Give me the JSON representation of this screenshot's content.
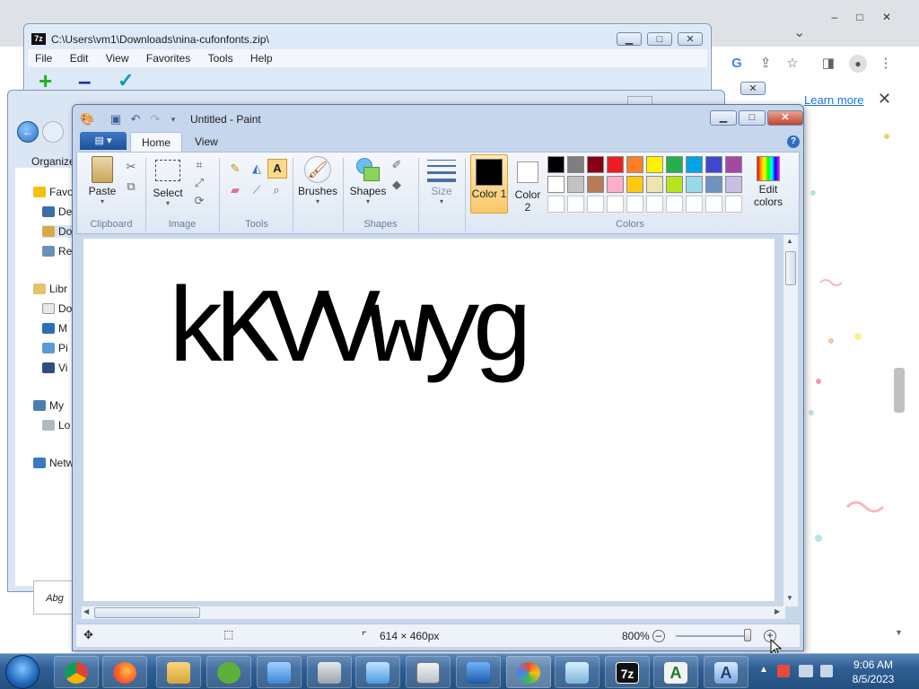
{
  "chrome": {
    "learn_more": "Learn more",
    "close_infobar": "✕",
    "window_controls": [
      "–",
      "□",
      "✕"
    ],
    "toolbar_icons": [
      "google-icon",
      "share-icon",
      "star-icon",
      "sidepanel-icon",
      "profile-icon",
      "menu-icon"
    ],
    "tab_dropdown": "⌄"
  },
  "sevenzip": {
    "title": "C:\\Users\\vm1\\Downloads\\nina-cufonfonts.zip\\",
    "menus": [
      "File",
      "Edit",
      "View",
      "Favorites",
      "Tools",
      "Help"
    ],
    "tool_add": "+",
    "tool_extract": "–",
    "tool_test": "✓"
  },
  "explorer": {
    "organize": "Organize",
    "nav_items": [
      {
        "label": "Favo",
        "icon": "star-icon"
      },
      {
        "label": "De",
        "icon": "desktop-icon"
      },
      {
        "label": "Do",
        "icon": "downloads-icon"
      },
      {
        "label": "Re",
        "icon": "recent-icon"
      },
      {
        "label": "Libr",
        "icon": "library-icon"
      },
      {
        "label": "Do",
        "icon": "documents-icon"
      },
      {
        "label": "M",
        "icon": "music-icon"
      },
      {
        "label": "Pi",
        "icon": "pictures-icon"
      },
      {
        "label": "Vi",
        "icon": "videos-icon"
      },
      {
        "label": "My",
        "icon": "computer-icon"
      },
      {
        "label": "Lo",
        "icon": "localdisk-icon"
      },
      {
        "label": "Netw",
        "icon": "network-icon"
      }
    ],
    "preview_text": "Abg"
  },
  "paint": {
    "title": "Untitled - Paint",
    "tabs": {
      "home": "Home",
      "view": "View"
    },
    "file_button": "▤ ▾",
    "help": "?",
    "caption": {
      "minimize": "▁",
      "maximize": "□",
      "close": "✕"
    },
    "groups": {
      "clipboard": "Clipboard",
      "image": "Image",
      "tools": "Tools",
      "shapes": "Shapes",
      "colors": "Colors"
    },
    "buttons": {
      "paste": "Paste",
      "select": "Select",
      "brushes": "Brushes",
      "shapes": "Shapes",
      "size": "Size",
      "color1": "Color 1",
      "color2": "Color 2",
      "edit_colors": "Edit colors"
    },
    "color1_value": "#000000",
    "color2_value": "#ffffff",
    "palette_row1": [
      "#000000",
      "#7f7f7f",
      "#880015",
      "#ed1c24",
      "#ff7f27",
      "#fff200",
      "#22b14c",
      "#00a2e8",
      "#3f48cc",
      "#a349a4"
    ],
    "palette_row2": [
      "#ffffff",
      "#c3c3c3",
      "#b97a57",
      "#ffaec9",
      "#ffc90e",
      "#efe4b0",
      "#b5e61d",
      "#99d9ea",
      "#7092be",
      "#c8bfe7"
    ],
    "canvas_text": "kKVVwyg",
    "status": {
      "dimensions": "614 × 460px",
      "zoom": "800%",
      "zoom_out": "–",
      "zoom_in": "+"
    }
  },
  "taskbar": {
    "apps": [
      "chrome",
      "firefox",
      "explorer",
      "utorrent",
      "control-panel",
      "printer",
      "mail",
      "calculator",
      "remote-desktop",
      "paint",
      "notepad",
      "7zip",
      "font-viewer",
      "font-editor"
    ],
    "sevenzip_label": "7z",
    "font_label": "A",
    "time": "9:06 AM",
    "date": "8/5/2023"
  }
}
